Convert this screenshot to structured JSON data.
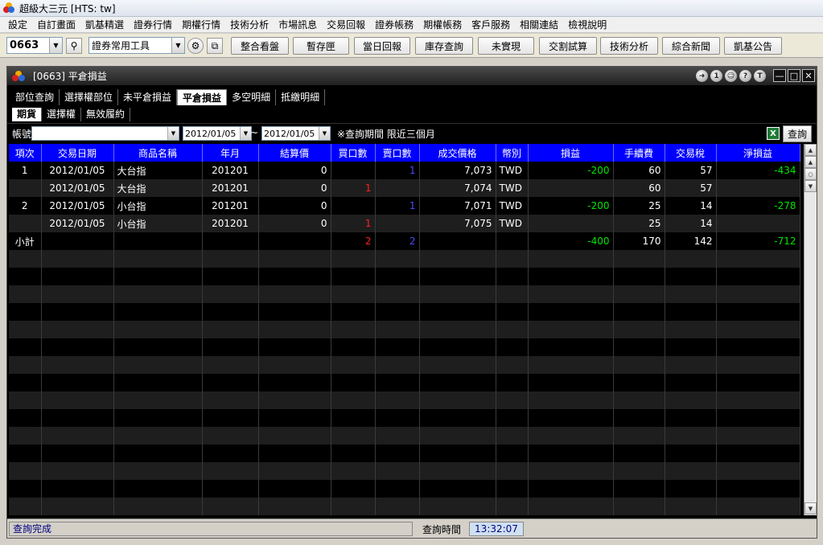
{
  "window": {
    "title": "超級大三元 [HTS: tw]"
  },
  "menu": [
    "設定",
    "自訂畫面",
    "凱基精選",
    "證券行情",
    "期權行情",
    "技術分析",
    "市場訊息",
    "交易回報",
    "證券帳務",
    "期權帳務",
    "客戶服務",
    "相關連結",
    "檢視說明"
  ],
  "toolbar": {
    "stock_code": "0663",
    "tool_group": "證券常用工具",
    "buttons": [
      "整合看盤",
      "暫存匣",
      "當日回報",
      "庫存查詢",
      "未實現",
      "交割試算",
      "技術分析",
      "綜合新聞",
      "凱基公告"
    ]
  },
  "inner": {
    "title": "[0663] 平倉損益",
    "round_buttons": [
      "1",
      "?",
      "T"
    ],
    "tabs": [
      "部位查詢",
      "選擇權部位",
      "未平倉損益",
      "平倉損益",
      "多空明細",
      "抵繳明細"
    ],
    "active_tab": "平倉損益",
    "subtabs": [
      "期貨",
      "選擇權",
      "無效履約"
    ],
    "active_subtab": "期貨"
  },
  "filter": {
    "account_label": "帳號",
    "account_value": "",
    "date_from": "2012/01/05",
    "date_to": "2012/01/05",
    "separator": "~",
    "note": "※查詢期間 限近三個月",
    "excel_icon": "X",
    "query_button": "查詢"
  },
  "grid": {
    "columns": [
      "項次",
      "交易日期",
      "商品名稱",
      "年月",
      "結算價",
      "買口數",
      "賣口數",
      "成交價格",
      "幣別",
      "損益",
      "手續費",
      "交易稅",
      "淨損益"
    ],
    "rows": [
      {
        "item": "1",
        "date": "2012/01/05",
        "product": "大台指",
        "ym": "201201",
        "settle": "0",
        "buy": "",
        "sell": "1",
        "price": "7,073",
        "currency": "TWD",
        "pnl": "-200",
        "fee": "60",
        "tax": "57",
        "net": "-434"
      },
      {
        "item": "",
        "date": "2012/01/05",
        "product": "大台指",
        "ym": "201201",
        "settle": "0",
        "buy": "1",
        "sell": "",
        "price": "7,074",
        "currency": "TWD",
        "pnl": "",
        "fee": "60",
        "tax": "57",
        "net": ""
      },
      {
        "item": "2",
        "date": "2012/01/05",
        "product": "小台指",
        "ym": "201201",
        "settle": "0",
        "buy": "",
        "sell": "1",
        "price": "7,071",
        "currency": "TWD",
        "pnl": "-200",
        "fee": "25",
        "tax": "14",
        "net": "-278"
      },
      {
        "item": "",
        "date": "2012/01/05",
        "product": "小台指",
        "ym": "201201",
        "settle": "0",
        "buy": "1",
        "sell": "",
        "price": "7,075",
        "currency": "TWD",
        "pnl": "",
        "fee": "25",
        "tax": "14",
        "net": ""
      }
    ],
    "subtotal": {
      "label": "小計",
      "buy": "2",
      "sell": "2",
      "pnl": "-400",
      "fee": "170",
      "tax": "142",
      "net": "-712"
    }
  },
  "status": {
    "message": "查詢完成",
    "time_label": "查詢時間",
    "time_value": "13:32:07"
  },
  "colors": {
    "header_blue": "#0000ff",
    "buy_red": "#ff2020",
    "sell_blue": "#4a4aff",
    "pnl_green": "#00e600"
  }
}
